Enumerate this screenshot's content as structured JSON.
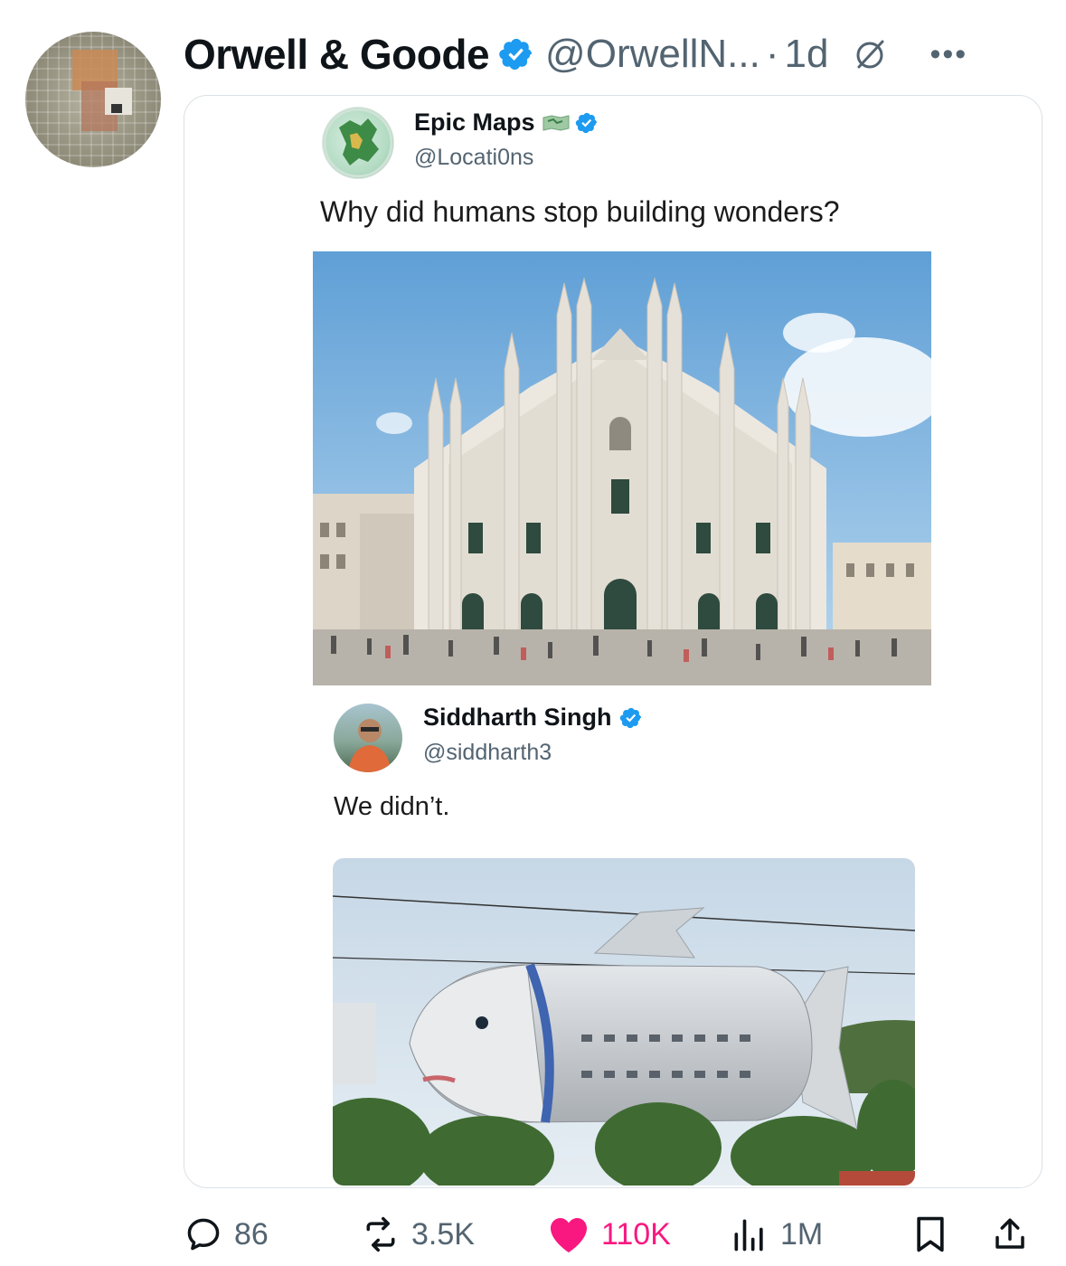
{
  "post": {
    "display_name": "Orwell & Goode",
    "handle": "@OrwellN...",
    "separator": "·",
    "time": "1d"
  },
  "quoted_post": {
    "display_name": "Epic Maps",
    "handle": "@Locati0ns",
    "text": "Why did humans stop building wonders?"
  },
  "reply_post": {
    "display_name": "Siddharth Singh",
    "handle": "@siddharth3",
    "text": "We didn’t."
  },
  "actions": {
    "replies": "86",
    "reposts": "3.5K",
    "likes": "110K",
    "views": "1M"
  },
  "colors": {
    "verified": "#1d9bf0",
    "like": "#f91880",
    "secondary_text": "#536471"
  },
  "icons": [
    "verified-badge-icon",
    "grok-icon",
    "more-icon",
    "reply-icon",
    "repost-icon",
    "heart-icon",
    "views-icon",
    "bookmark-icon",
    "share-icon"
  ]
}
